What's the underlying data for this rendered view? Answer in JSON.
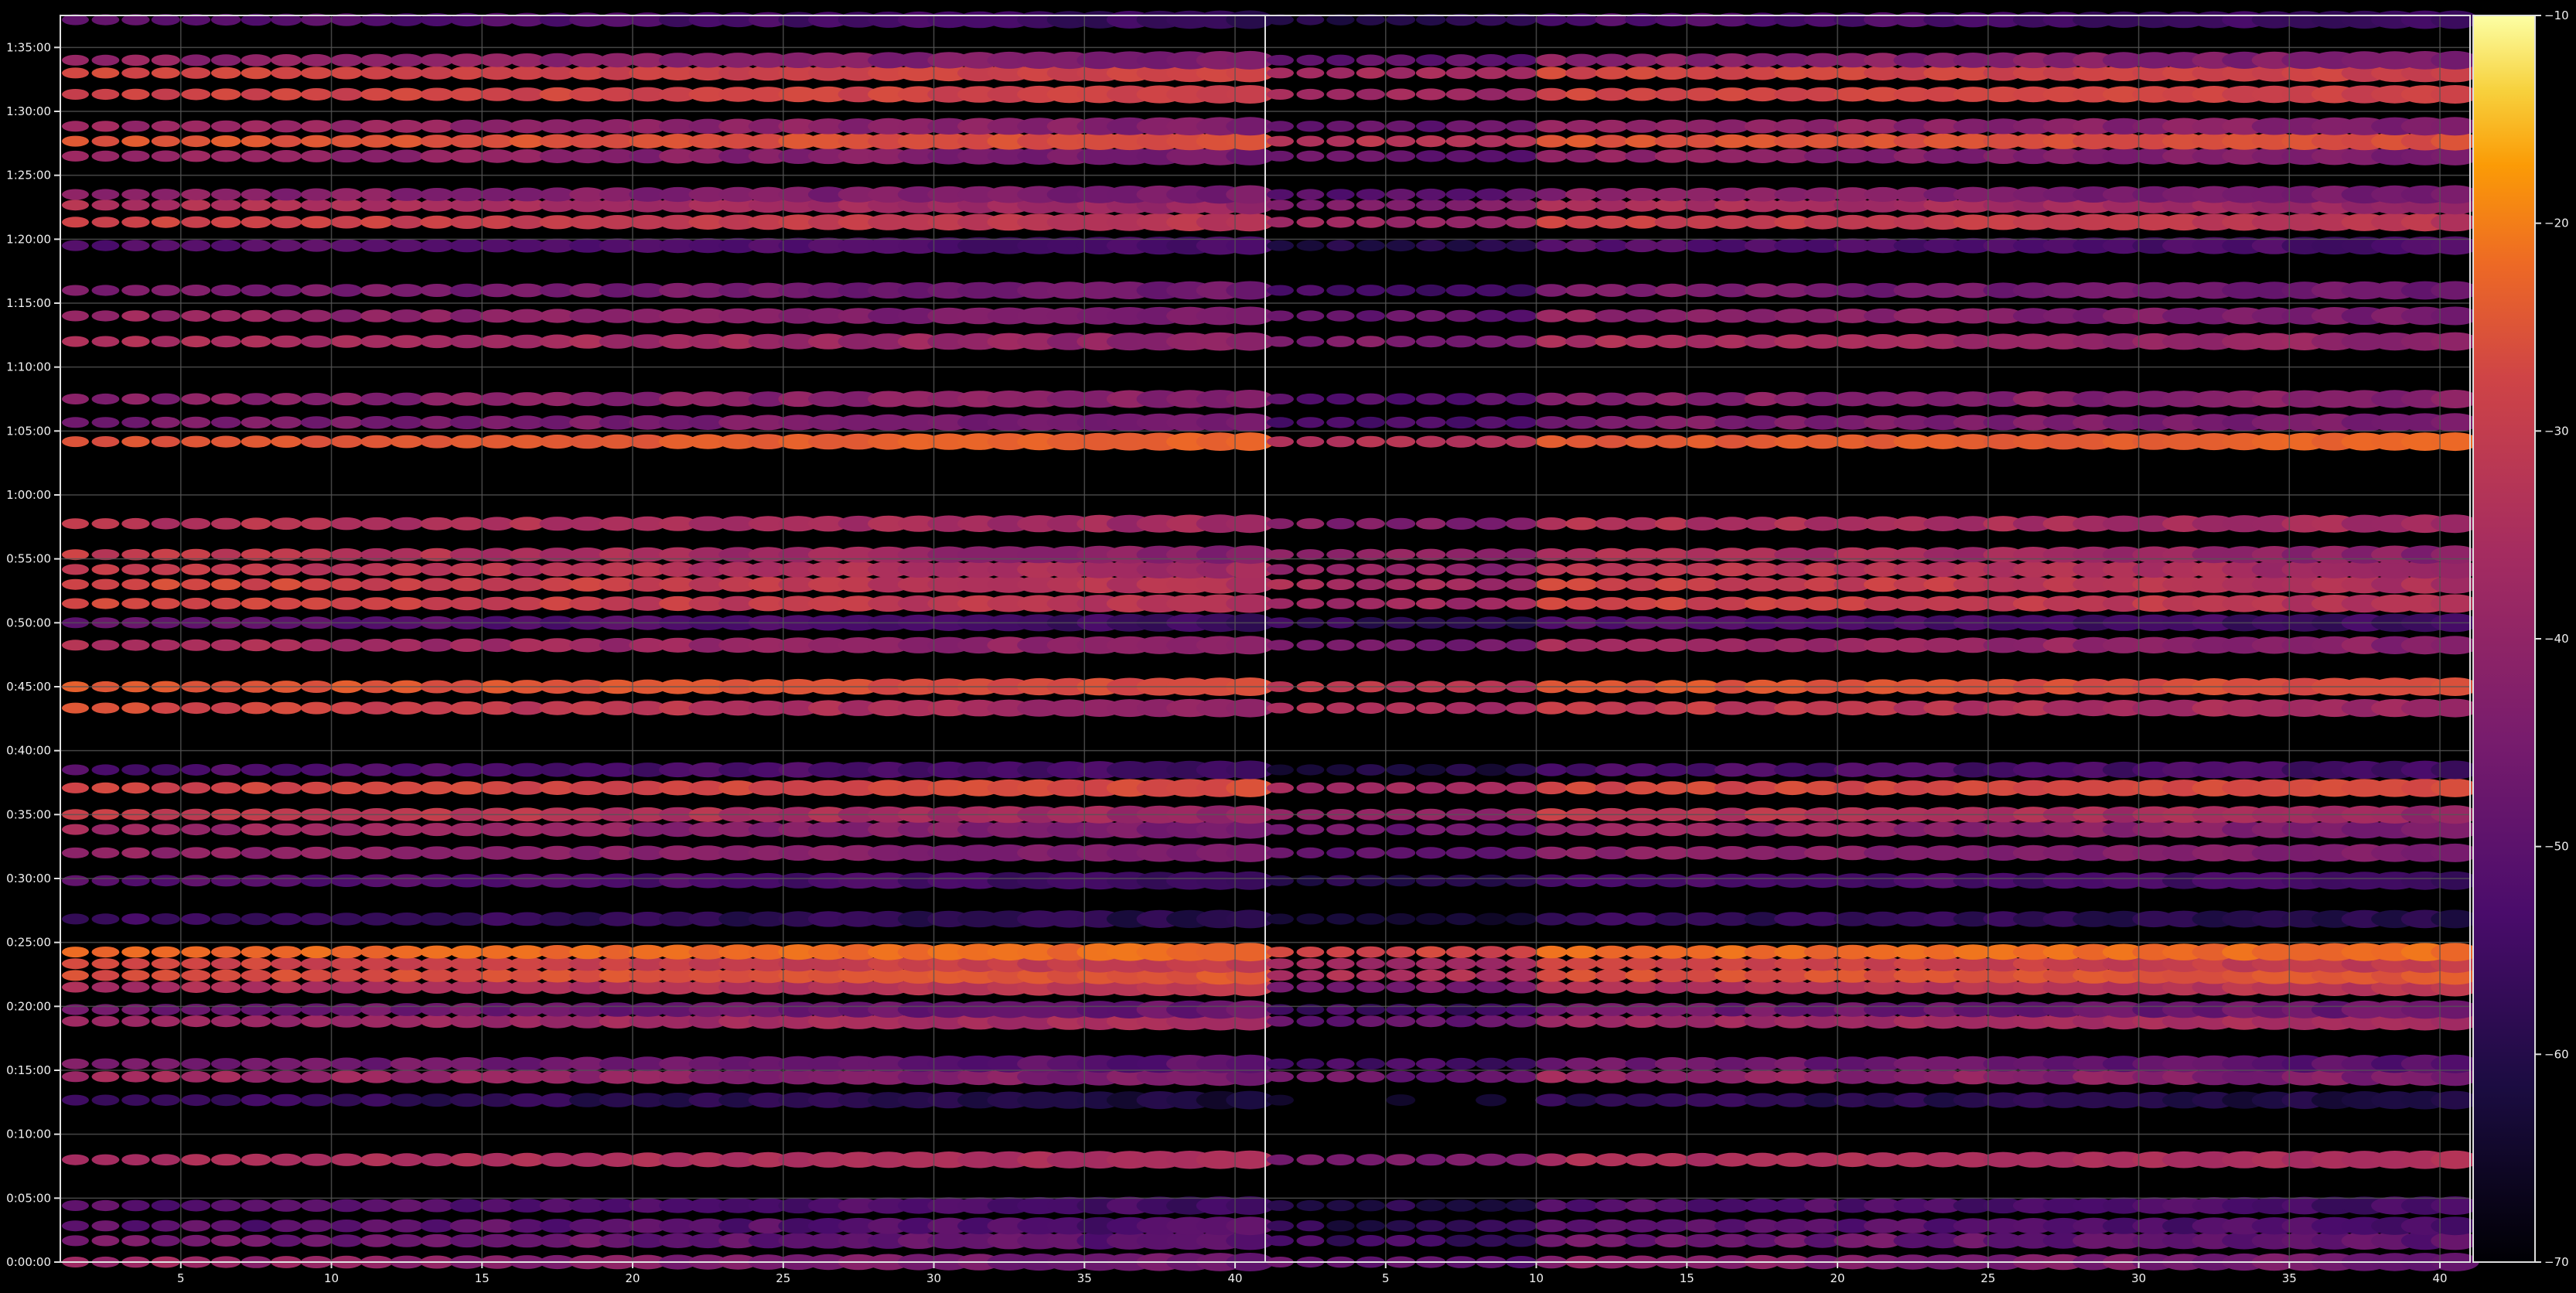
{
  "chart_data": {
    "type": "heatmap",
    "title": "",
    "xlabel": "",
    "ylabel": "",
    "grid": true,
    "background": "#000000",
    "grid_color": "#555555",
    "colormap": "inferno",
    "panels": [
      {
        "name": "",
        "xlim": [
          1,
          40
        ],
        "x_ticks": [
          5,
          10,
          15,
          20,
          25,
          30,
          35,
          40
        ],
        "x_tick_labels": [
          "5",
          "10",
          "15",
          "20",
          "25",
          "30",
          "35",
          "40"
        ]
      },
      {
        "name": "",
        "xlim": [
          1,
          40
        ],
        "x_ticks": [
          5,
          10,
          15,
          20,
          25,
          30,
          35,
          40
        ],
        "x_tick_labels": [
          "5",
          "10",
          "15",
          "20",
          "25",
          "30",
          "35",
          "40"
        ]
      }
    ],
    "y_axis": {
      "unit": "time",
      "ylim_seconds": [
        0,
        5850
      ],
      "ticks_seconds": [
        0,
        300,
        600,
        900,
        1200,
        1500,
        1800,
        2100,
        2400,
        2700,
        3000,
        3300,
        3600,
        3900,
        4200,
        4500,
        4800,
        5100,
        5400,
        5700
      ],
      "tick_labels": [
        "0:00:00",
        "0:05:00",
        "0:10:00",
        "0:15:00",
        "0:20:00",
        "0:25:00",
        "0:30:00",
        "0:35:00",
        "0:40:00",
        "0:45:00",
        "0:50:00",
        "0:55:00",
        "1:00:00",
        "1:05:00",
        "1:10:00",
        "1:15:00",
        "1:20:00",
        "1:25:00",
        "1:30:00",
        "1:35:00"
      ]
    },
    "colorbar": {
      "range": [
        -70,
        -10
      ],
      "ticks": [
        -70,
        -60,
        -50,
        -40,
        -30,
        -20,
        -10
      ],
      "tick_labels": [
        "−70",
        "−60",
        "−50",
        "−40",
        "−30",
        "−20",
        "−10"
      ]
    },
    "bands": [
      {
        "t": 0,
        "level": -46,
        "slope": -8,
        "jitter": 6
      },
      {
        "t": 100,
        "level": -50,
        "slope": -4,
        "jitter": 7
      },
      {
        "t": 170,
        "level": -53,
        "slope": -2,
        "jitter": 7
      },
      {
        "t": 265,
        "level": -54,
        "slope": -4,
        "jitter": 6
      },
      {
        "t": 480,
        "level": -39,
        "slope": 0,
        "jitter": 3
      },
      {
        "t": 760,
        "level": -60,
        "slope": -6,
        "jitter": 5
      },
      {
        "t": 870,
        "level": -44,
        "slope": -6,
        "jitter": 6
      },
      {
        "t": 930,
        "level": -50,
        "slope": -6,
        "jitter": 6
      },
      {
        "t": 1130,
        "level": -41,
        "slope": 4,
        "jitter": 4
      },
      {
        "t": 1185,
        "level": -49,
        "slope": -2,
        "jitter": 6
      },
      {
        "t": 1290,
        "level": -38,
        "slope": 3,
        "jitter": 4
      },
      {
        "t": 1345,
        "level": -30,
        "slope": 2,
        "jitter": 4
      },
      {
        "t": 1400,
        "level": -34,
        "slope": -3,
        "jitter": 4
      },
      {
        "t": 1455,
        "level": -25,
        "slope": 0,
        "jitter": 4
      },
      {
        "t": 1610,
        "level": -59,
        "slope": -4,
        "jitter": 5
      },
      {
        "t": 1790,
        "level": -55,
        "slope": -4,
        "jitter": 5
      },
      {
        "t": 1920,
        "level": -45,
        "slope": -4,
        "jitter": 4
      },
      {
        "t": 2030,
        "level": -44,
        "slope": -6,
        "jitter": 5
      },
      {
        "t": 2100,
        "level": -38,
        "slope": -8,
        "jitter": 5
      },
      {
        "t": 2225,
        "level": -32,
        "slope": 2,
        "jitter": 4
      },
      {
        "t": 2310,
        "level": -55,
        "slope": -2,
        "jitter": 5
      },
      {
        "t": 2600,
        "level": -37,
        "slope": -12,
        "jitter": 5
      },
      {
        "t": 2700,
        "level": -30,
        "slope": -4,
        "jitter": 4
      },
      {
        "t": 2895,
        "level": -42,
        "slope": -6,
        "jitter": 5
      },
      {
        "t": 3000,
        "level": -54,
        "slope": -8,
        "jitter": 5
      },
      {
        "t": 3090,
        "level": -35,
        "slope": -6,
        "jitter": 5
      },
      {
        "t": 3180,
        "level": -35,
        "slope": -8,
        "jitter": 5
      },
      {
        "t": 3250,
        "level": -38,
        "slope": -6,
        "jitter": 5
      },
      {
        "t": 3320,
        "level": -40,
        "slope": -10,
        "jitter": 5
      },
      {
        "t": 3465,
        "level": -39,
        "slope": -4,
        "jitter": 5
      },
      {
        "t": 3850,
        "level": -28,
        "slope": 4,
        "jitter": 3
      },
      {
        "t": 3940,
        "level": -47,
        "slope": 0,
        "jitter": 5
      },
      {
        "t": 4050,
        "level": -45,
        "slope": 0,
        "jitter": 5
      },
      {
        "t": 4320,
        "level": -41,
        "slope": -6,
        "jitter": 5
      },
      {
        "t": 4440,
        "level": -45,
        "slope": -6,
        "jitter": 5
      },
      {
        "t": 4560,
        "level": -48,
        "slope": -2,
        "jitter": 5
      },
      {
        "t": 4770,
        "level": -54,
        "slope": -2,
        "jitter": 5
      },
      {
        "t": 4880,
        "level": -35,
        "slope": -4,
        "jitter": 4
      },
      {
        "t": 4960,
        "level": -40,
        "slope": -4,
        "jitter": 4
      },
      {
        "t": 5010,
        "level": -46,
        "slope": -4,
        "jitter": 5
      },
      {
        "t": 5190,
        "level": -45,
        "slope": -6,
        "jitter": 5
      },
      {
        "t": 5260,
        "level": -30,
        "slope": -2,
        "jitter": 4
      },
      {
        "t": 5330,
        "level": -44,
        "slope": -4,
        "jitter": 5
      },
      {
        "t": 5480,
        "level": -33,
        "slope": 0,
        "jitter": 4
      },
      {
        "t": 5580,
        "level": -33,
        "slope": -2,
        "jitter": 4
      },
      {
        "t": 5640,
        "level": -45,
        "slope": -4,
        "jitter": 5
      },
      {
        "t": 5830,
        "level": -55,
        "slope": -6,
        "jitter": 5
      }
    ]
  }
}
